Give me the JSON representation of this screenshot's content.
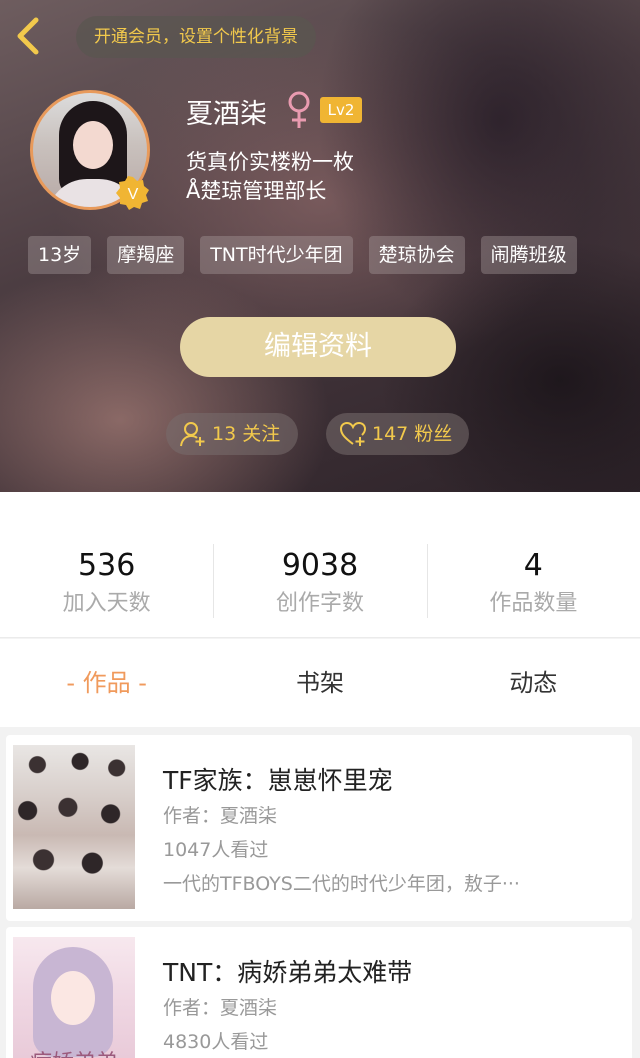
{
  "header": {
    "vip_banner": "开通会员，设置个性化背景",
    "username": "夏酒柒",
    "level": "Lv2",
    "avatar_badge": "V",
    "bio_line1": "货真价实楼粉一枚",
    "bio_line2": "Å楚琼管理部长",
    "tags": [
      "13岁",
      "摩羯座",
      "TNT时代少年团",
      "楚琼协会",
      "闹腾班级"
    ],
    "edit_button": "编辑资料",
    "follow_label": "13 关注",
    "fans_label": "147 粉丝",
    "colors": {
      "accent": "#f2c94c",
      "level_badge": "#f0b533",
      "avatar_border": "#e89a5b",
      "edit_button": "#e6d6a5"
    }
  },
  "stats": [
    {
      "value": "536",
      "label": "加入天数"
    },
    {
      "value": "9038",
      "label": "创作字数"
    },
    {
      "value": "4",
      "label": "作品数量"
    }
  ],
  "tabs": [
    {
      "label": "- 作品 -",
      "active": true
    },
    {
      "label": "书架",
      "active": false
    },
    {
      "label": "动态",
      "active": false
    }
  ],
  "tab_active_color": "#f09a5c",
  "works": [
    {
      "title": "TF家族：崽崽怀里宠",
      "author": "作者：夏酒柒",
      "views": "1047人看过",
      "description": "一代的TFBOYS二代的时代少年团，敖子···"
    },
    {
      "title": "TNT：病娇弟弟太难带",
      "author": "作者：夏酒柒",
      "views": "4830人看过",
      "cover_text": "病娇弟弟"
    }
  ],
  "icons": {
    "back": "chevron-left-icon",
    "gender": "female-icon",
    "follow": "user-add-icon",
    "fans": "heart-add-icon",
    "verified": "verified-badge-icon"
  }
}
